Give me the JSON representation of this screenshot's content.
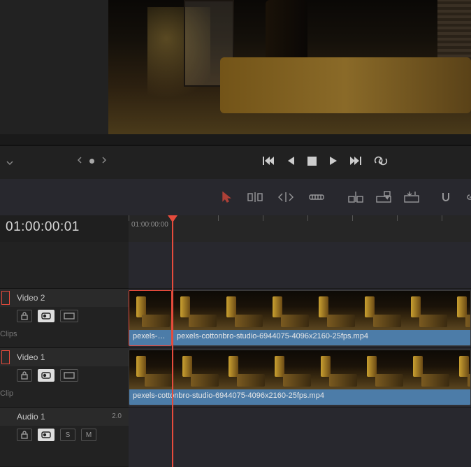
{
  "timecode": "01:00:00:01",
  "ruler_start": "01:00:00:00",
  "tracks": {
    "video2": {
      "name": "Video 2",
      "subtitle": "Clips"
    },
    "video1": {
      "name": "Video 1",
      "subtitle": "Clip"
    },
    "audio1": {
      "name": "Audio 1",
      "channels": "2.0"
    }
  },
  "clips": {
    "v2a": "pexels-c...",
    "v2b": "pexels-cottonbro-studio-6944075-4096x2160-25fps.mp4",
    "v1": "pexels-cottonbro-studio-6944075-4096x2160-25fps.mp4"
  },
  "audio_toggles": {
    "solo": "S",
    "mute": "M"
  }
}
